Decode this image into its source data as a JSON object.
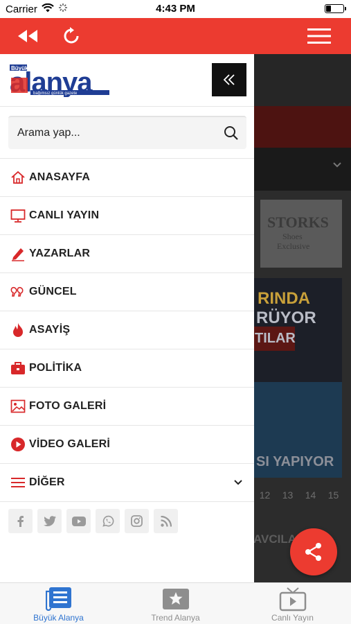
{
  "status_bar": {
    "carrier": "Carrier",
    "time": "4:43 PM",
    "battery_level": 0.3
  },
  "toolbar": {
    "color": "#ec3b30",
    "icons": [
      "rewind-icon",
      "refresh-icon",
      "hamburger-menu-icon"
    ]
  },
  "drawer": {
    "logo": {
      "small_text": "Büyük",
      "brand_text": "alanya",
      "tagline": "bağımsız günlük gazete"
    },
    "search": {
      "placeholder": "Arama yap..."
    },
    "menu": [
      {
        "label": "ANASAYFA",
        "icon": "home-icon"
      },
      {
        "label": "CANLI YAYIN",
        "icon": "monitor-icon"
      },
      {
        "label": "YAZARLAR",
        "icon": "pen-icon"
      },
      {
        "label": "GÜNCEL",
        "icon": "quote-icon"
      },
      {
        "label": "ASAYİŞ",
        "icon": "fire-icon"
      },
      {
        "label": "POLİTİKA",
        "icon": "briefcase-icon"
      },
      {
        "label": "FOTO GALERİ",
        "icon": "image-icon"
      },
      {
        "label": "VİDEO GALERİ",
        "icon": "play-circle-icon"
      },
      {
        "label": "DİĞER",
        "icon": "list-icon"
      }
    ],
    "socials": [
      "facebook-icon",
      "twitter-icon",
      "youtube-icon",
      "whatsapp-icon",
      "instagram-icon",
      "rss-icon"
    ]
  },
  "background": {
    "ad_text_1": "STORKS",
    "ad_text_2": "Shoes",
    "ad_text_3": "Exclusive",
    "headline_1": "RINDA",
    "headline_2": "RÜYOR",
    "headline_3": "TILAR",
    "headline_4": "SI YAPIYOR",
    "dates": [
      "12",
      "13",
      "14",
      "15"
    ],
    "bottom_text": "AVCILA"
  },
  "tabs": [
    {
      "label": "Büyük Alanya",
      "active": true,
      "icon": "news-icon"
    },
    {
      "label": "Trend Alanya",
      "active": false,
      "icon": "star-tv-icon"
    },
    {
      "label": "Canlı Yayın",
      "active": false,
      "icon": "tv-icon"
    }
  ],
  "colors": {
    "accent": "#ec3b30",
    "tab_active": "#2f74d0",
    "tab_inactive": "#8e8e8e",
    "menu_icon": "#d8282a"
  }
}
